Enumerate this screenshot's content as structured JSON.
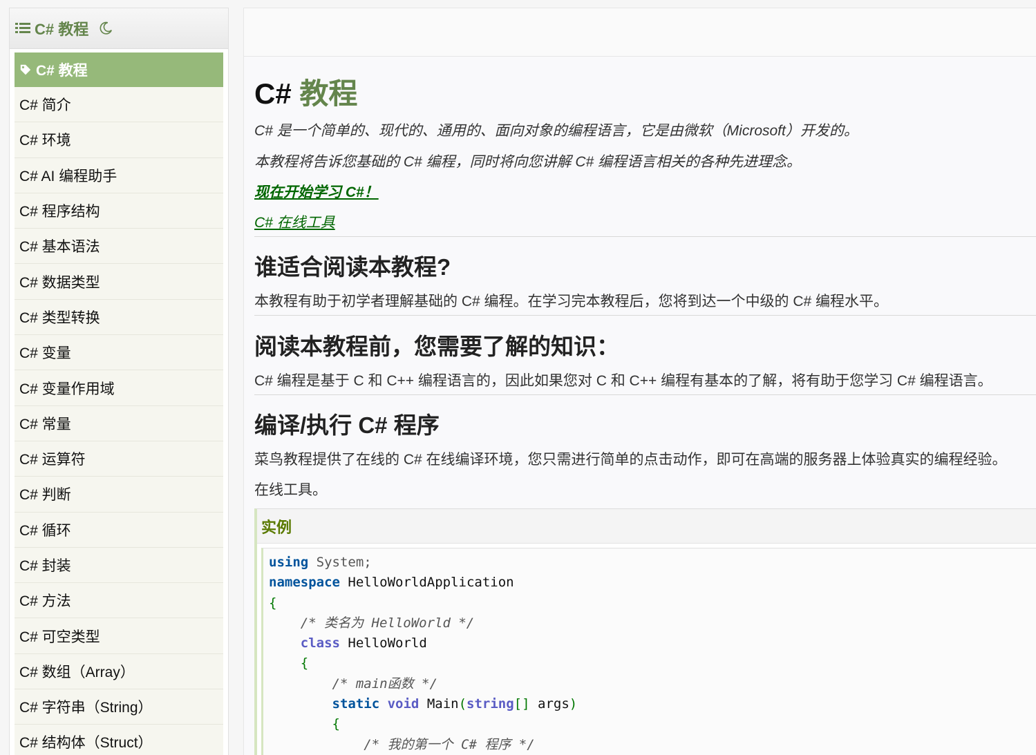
{
  "sidebar": {
    "title": "C# 教程",
    "items": [
      {
        "label": "C# 教程",
        "active": true
      },
      {
        "label": "C# 简介"
      },
      {
        "label": "C# 环境"
      },
      {
        "label": "C# AI 编程助手"
      },
      {
        "label": "C# 程序结构"
      },
      {
        "label": "C# 基本语法"
      },
      {
        "label": "C# 数据类型"
      },
      {
        "label": "C# 类型转换"
      },
      {
        "label": "C# 变量"
      },
      {
        "label": "C# 变量作用域"
      },
      {
        "label": "C# 常量"
      },
      {
        "label": "C# 运算符"
      },
      {
        "label": "C# 判断"
      },
      {
        "label": "C# 循环"
      },
      {
        "label": "C# 封装"
      },
      {
        "label": "C# 方法"
      },
      {
        "label": "C# 可空类型"
      },
      {
        "label": "C# 数组（Array）"
      },
      {
        "label": "C# 字符串（String）"
      },
      {
        "label": "C# 结构体（Struct）"
      }
    ]
  },
  "main": {
    "title_prefix": "C#",
    "title_accent": "教程",
    "intro1": "C# 是一个简单的、现代的、通用的、面向对象的编程语言，它是由微软（Microsoft）开发的。",
    "intro2": "本教程将告诉您基础的 C# 编程，同时将向您讲解 C# 编程语言相关的各种先进理念。",
    "link_start": "现在开始学习 C#！",
    "link_tool": "C# 在线工具",
    "h2_who": "谁适合阅读本教程?",
    "p_who": "本教程有助于初学者理解基础的 C# 编程。在学习完本教程后，您将到达一个中级的 C# 编程水平。",
    "h2_prereq": "阅读本教程前，您需要了解的知识：",
    "p_prereq": "C# 编程是基于 C 和 C++ 编程语言的，因此如果您对 C 和 C++ 编程有基本的了解，将有助于您学习 C# 编程语言。",
    "h2_compile": "编译/执行 C# 程序",
    "p_compile": "菜鸟教程提供了在线的 C# 在线编译环境，您只需进行简单的点击动作，即可在高端的服务器上体验真实的编程经验。",
    "p_compile2": "在线工具。",
    "example_title": "实例"
  },
  "code": {
    "l1_kw": "using",
    "l1_rest": " System;",
    "l2_kw": "namespace",
    "l2_rest": " HelloWorldApplication",
    "l3": "{",
    "l4": "    /* 类名为 HelloWorld */",
    "l5_indent": "    ",
    "l5_kw": "class",
    "l5_rest": " HelloWorld",
    "l6": "    {",
    "l7": "        /* main函数 */",
    "l8_indent": "        ",
    "l8_kw1": "static",
    "l8_kw2": "void",
    "l8_name": " Main",
    "l8_p1": "(",
    "l8_kw3": "string",
    "l8_arr": "[]",
    "l8_args": " args",
    "l8_p2": ")",
    "l9": "        {",
    "l10": "            /* 我的第一个 C# 程序 */"
  }
}
